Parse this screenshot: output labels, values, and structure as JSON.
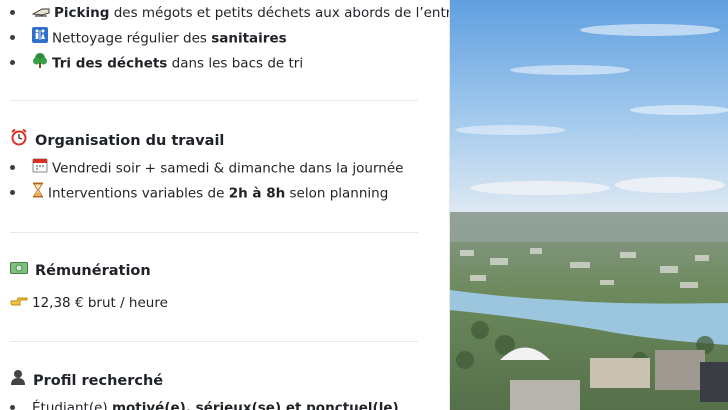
{
  "bullets_top": [
    {
      "icon": "broom-icon",
      "bold": "Picking",
      "rest": " des mégots et petits déchets aux abords de l’entrée"
    },
    {
      "icon": "restroom-icon",
      "pre": "Nettoyage régulier des ",
      "bold": "sanitaires",
      "rest": ""
    },
    {
      "icon": "recycle-tree-icon",
      "bold": "Tri des déchets",
      "rest": " dans les bacs de tri"
    }
  ],
  "organisation": {
    "title": "Organisation du travail",
    "items": [
      {
        "text": "Vendredi soir + samedi & dimanche dans la journée"
      },
      {
        "pre": "Interventions variables de ",
        "bold": "2h à 8h",
        "rest": " selon planning"
      }
    ]
  },
  "remuneration": {
    "title": "Rémunération",
    "value": "12,38 € brut / heure"
  },
  "profil": {
    "title": "Profil recherché",
    "first_item": {
      "pre": "Étudiant(e) ",
      "bold": "motivé(e), sérieux(se) et ponctuel(le)"
    }
  },
  "colors": {
    "accent_red": "#d93025",
    "sky": "#7cb3e8",
    "river": "#9cc6de"
  }
}
